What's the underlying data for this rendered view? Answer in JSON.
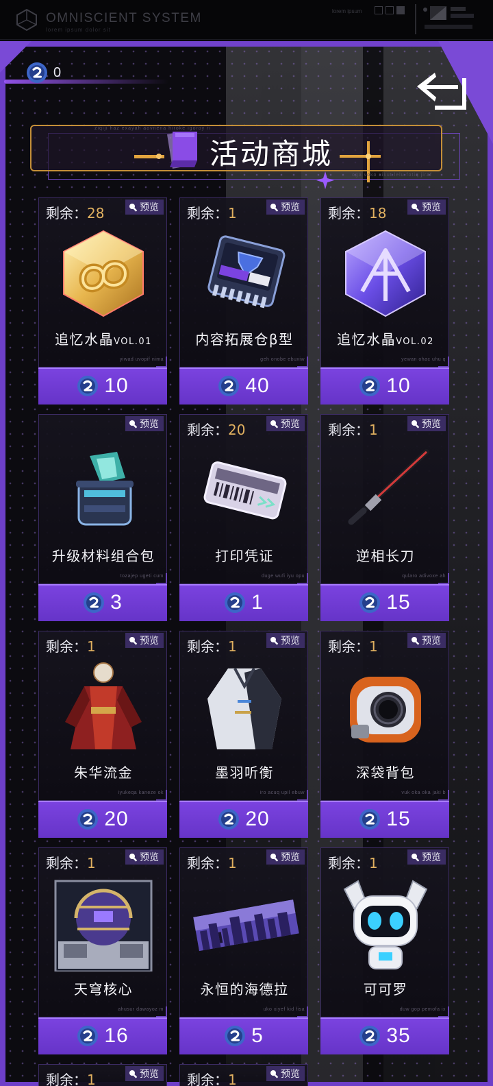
{
  "system_bar": {
    "title": "OMNISCIENT SYSTEM",
    "subtitle": "lorem ipsum dolor sit",
    "right_text": "lorem ipsum"
  },
  "wallet": {
    "balance": "0"
  },
  "banner": {
    "title": "活动商城",
    "caption_top": "ziqiji haz exayah aovnena hiroke igoroy ri",
    "caption_bottom": "oga voko xikut lelu fotiq jiraf"
  },
  "labels": {
    "remaining": "剩余：",
    "preview": "预览"
  },
  "items": [
    {
      "name": "追忆水晶",
      "vol": "VOL.01",
      "remaining": "28",
      "price": "10",
      "code": "yiwad uvopif nima",
      "icon": "gold-crystal-icon"
    },
    {
      "name": "内容拓展仓β型",
      "vol": "",
      "remaining": "1",
      "price": "40",
      "code": "geh onobe ebuxiw",
      "icon": "chip-module-icon"
    },
    {
      "name": "追忆水晶",
      "vol": "VOL.02",
      "remaining": "18",
      "price": "10",
      "code": "yewan ohac uhu q",
      "icon": "purple-crystal-icon"
    },
    {
      "name": "升级材料组合包",
      "vol": "",
      "remaining": "",
      "price": "3",
      "code": "tozajep ugeti cum",
      "icon": "material-box-icon"
    },
    {
      "name": "打印凭证",
      "vol": "",
      "remaining": "20",
      "price": "1",
      "code": "duge wufi iyu opu",
      "icon": "ticket-icon"
    },
    {
      "name": "逆相长刀",
      "vol": "",
      "remaining": "1",
      "price": "15",
      "code": "qularo adivoxe ah",
      "icon": "long-blade-icon"
    },
    {
      "name": "朱华流金",
      "vol": "",
      "remaining": "1",
      "price": "20",
      "code": "iyukeqa kaneze ok",
      "icon": "red-outfit-icon"
    },
    {
      "name": "墨羽听衡",
      "vol": "",
      "remaining": "1",
      "price": "20",
      "code": "iro acuq upil ebuw",
      "icon": "white-coat-icon"
    },
    {
      "name": "深袋背包",
      "vol": "",
      "remaining": "1",
      "price": "15",
      "code": "vuk oka oka jaki b",
      "icon": "backpack-icon"
    },
    {
      "name": "天穹核心",
      "vol": "",
      "remaining": "1",
      "price": "16",
      "code": "ahusur dawayoz m",
      "icon": "dome-core-icon"
    },
    {
      "name": "永恒的海德拉",
      "vol": "",
      "remaining": "1",
      "price": "5",
      "code": "uko xiyef kid fisa",
      "icon": "city-banner-icon"
    },
    {
      "name": "可可罗",
      "vol": "",
      "remaining": "1",
      "price": "35",
      "code": "duw gop pemofa ix",
      "icon": "robot-pet-icon"
    },
    {
      "name": "",
      "vol": "",
      "remaining": "1",
      "price": "",
      "code": "",
      "icon": ""
    },
    {
      "name": "",
      "vol": "",
      "remaining": "1",
      "price": "",
      "code": "",
      "icon": ""
    }
  ],
  "colors": {
    "accent": "#7b43e0",
    "gold": "#e0b060",
    "panel_border": "#3b2b63"
  }
}
